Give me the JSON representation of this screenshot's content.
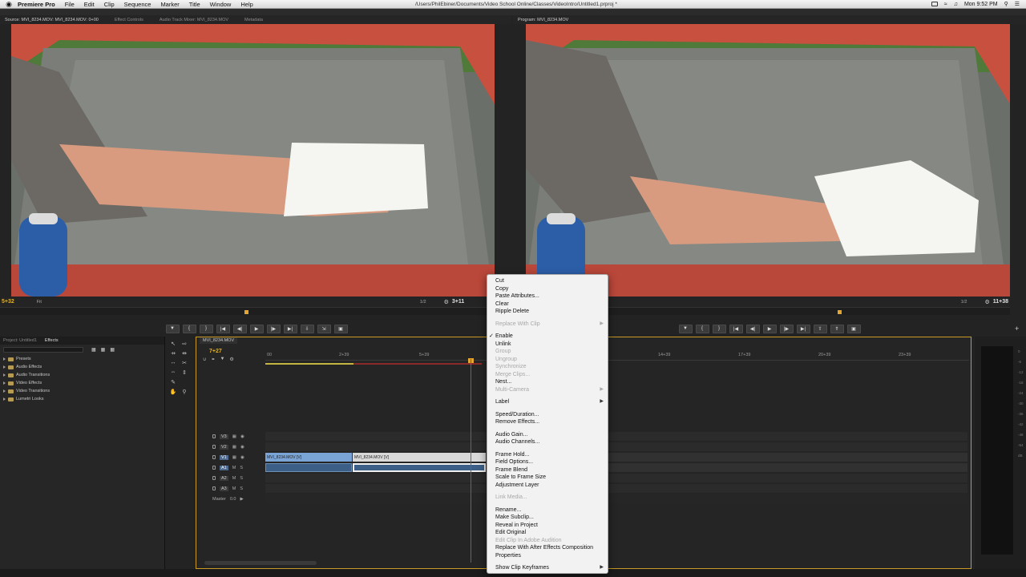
{
  "menubar": {
    "app": "Premiere Pro",
    "items": [
      "File",
      "Edit",
      "Clip",
      "Sequence",
      "Marker",
      "Title",
      "Window",
      "Help"
    ],
    "path": "/Users/PhilEbiner/Documents/Video School Online/Classes/VideoIntro/Untitled1.prproj *",
    "clock": "Mon 9:52 PM"
  },
  "source_monitor": {
    "tabs": [
      "Source: MVI_8234.MOV: MVI_8234.MOV: 0+00",
      "Effect Controls",
      "Audio Track Mixer: MVI_8234.MOV",
      "Metadata"
    ],
    "timecode": "5+32",
    "zoom": "Fit",
    "scale": "1/2",
    "duration": "3+11"
  },
  "program_monitor": {
    "tab": "Program: MVI_8234.MOV",
    "scale": "1/2",
    "duration": "11+38"
  },
  "effects_panel": {
    "tabs": [
      "Project: Untitled1",
      "Effects"
    ],
    "folders": [
      "Presets",
      "Audio Effects",
      "Audio Transitions",
      "Video Effects",
      "Video Transitions",
      "Lumetri Looks"
    ]
  },
  "timeline": {
    "tab": "MVI_8234.MOV",
    "timecode": "7+27",
    "ruler_labels": [
      "00",
      "2+39",
      "5+39",
      "14+39",
      "17+39",
      "20+39",
      "23+39"
    ],
    "video_tracks": [
      "V3",
      "V2",
      "V1"
    ],
    "audio_tracks": [
      "A1",
      "A2",
      "A3"
    ],
    "master_label": "Master",
    "master_value": "0.0",
    "clips": {
      "v1_first": "MVI_8234.MOV [V]",
      "v1_second": "MVI_8234.MOV [V]"
    }
  },
  "context_menu": {
    "items": [
      {
        "label": "Cut",
        "enabled": true
      },
      {
        "label": "Copy",
        "enabled": true
      },
      {
        "label": "Paste Attributes...",
        "enabled": true
      },
      {
        "label": "Clear",
        "enabled": true
      },
      {
        "label": "Ripple Delete",
        "enabled": true
      },
      {
        "sep": true
      },
      {
        "label": "Replace With Clip",
        "enabled": false,
        "submenu": true
      },
      {
        "sep": true
      },
      {
        "label": "Enable",
        "enabled": true,
        "checked": true
      },
      {
        "label": "Unlink",
        "enabled": true
      },
      {
        "label": "Group",
        "enabled": false
      },
      {
        "label": "Ungroup",
        "enabled": false
      },
      {
        "label": "Synchronize",
        "enabled": false
      },
      {
        "label": "Merge Clips...",
        "enabled": false
      },
      {
        "label": "Nest...",
        "enabled": true
      },
      {
        "label": "Multi-Camera",
        "enabled": false,
        "submenu": true
      },
      {
        "sep": true
      },
      {
        "label": "Label",
        "enabled": true,
        "submenu": true
      },
      {
        "sep": true
      },
      {
        "label": "Speed/Duration...",
        "enabled": true
      },
      {
        "label": "Remove Effects...",
        "enabled": true
      },
      {
        "sep": true
      },
      {
        "label": "Audio Gain...",
        "enabled": true
      },
      {
        "label": "Audio Channels...",
        "enabled": true
      },
      {
        "sep": true
      },
      {
        "label": "Frame Hold...",
        "enabled": true
      },
      {
        "label": "Field Options...",
        "enabled": true
      },
      {
        "label": "Frame Blend",
        "enabled": true
      },
      {
        "label": "Scale to Frame Size",
        "enabled": true
      },
      {
        "label": "Adjustment Layer",
        "enabled": true
      },
      {
        "sep": true
      },
      {
        "label": "Link Media...",
        "enabled": false
      },
      {
        "sep": true
      },
      {
        "label": "Rename...",
        "enabled": true
      },
      {
        "label": "Make Subclip...",
        "enabled": true
      },
      {
        "label": "Reveal in Project",
        "enabled": true
      },
      {
        "label": "Edit Original",
        "enabled": true
      },
      {
        "label": "Edit Clip In Adobe Audition",
        "enabled": false
      },
      {
        "label": "Replace With After Effects Composition",
        "enabled": true
      },
      {
        "label": "Properties",
        "enabled": true
      },
      {
        "sep": true
      },
      {
        "label": "Show Clip Keyframes",
        "enabled": true,
        "submenu": true
      }
    ]
  },
  "colors": {
    "timecode": "#e5b220",
    "panel_bg": "#232323",
    "menu_bg": "#f2f2f2",
    "clip_video": "#7aa3d6",
    "clip_audio": "#3b5f86",
    "playhead": "#c63b3b"
  }
}
